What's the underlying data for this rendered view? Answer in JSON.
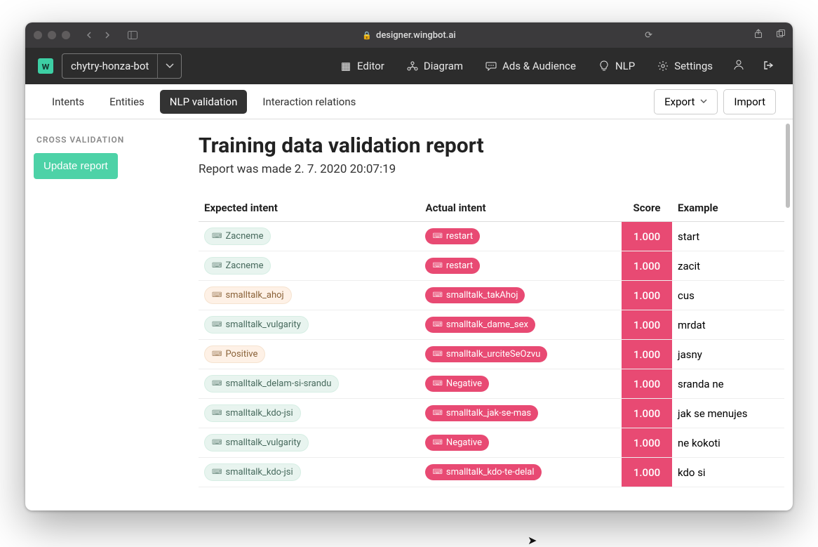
{
  "browser": {
    "url": "designer.wingbot.ai"
  },
  "topnav": {
    "bot_name": "chytry-honza-bot",
    "items": {
      "editor": "Editor",
      "diagram": "Diagram",
      "ads": "Ads & Audience",
      "nlp": "NLP",
      "settings": "Settings"
    }
  },
  "subnav": {
    "intents": "Intents",
    "entities": "Entities",
    "nlp_validation": "NLP validation",
    "interaction_relations": "Interaction relations",
    "export": "Export",
    "import": "Import"
  },
  "sidebar": {
    "heading": "CROSS VALIDATION",
    "update_button": "Update report"
  },
  "report": {
    "title": "Training data validation report",
    "subtitle": "Report was made 2. 7. 2020 20:07:19",
    "columns": {
      "expected": "Expected intent",
      "actual": "Actual intent",
      "score": "Score",
      "example": "Example"
    },
    "rows": [
      {
        "expected": "Zacneme",
        "expected_tone": "cool",
        "actual": "restart",
        "score": "1.000",
        "example": "start"
      },
      {
        "expected": "Zacneme",
        "expected_tone": "cool",
        "actual": "restart",
        "score": "1.000",
        "example": "zacit"
      },
      {
        "expected": "smalltalk_ahoj",
        "expected_tone": "warm",
        "actual": "smalltalk_takAhoj",
        "score": "1.000",
        "example": "cus"
      },
      {
        "expected": "smalltalk_vulgarity",
        "expected_tone": "cool",
        "actual": "smalltalk_dame_sex",
        "score": "1.000",
        "example": "mrdat"
      },
      {
        "expected": "Positive",
        "expected_tone": "warm",
        "actual": "smalltalk_urciteSeOzvu",
        "score": "1.000",
        "example": "jasny"
      },
      {
        "expected": "smalltalk_delam-si-srandu",
        "expected_tone": "cool",
        "actual": "Negative",
        "score": "1.000",
        "example": "sranda ne"
      },
      {
        "expected": "smalltalk_kdo-jsi",
        "expected_tone": "cool",
        "actual": "smalltalk_jak-se-mas",
        "score": "1.000",
        "example": "jak se menujes"
      },
      {
        "expected": "smalltalk_vulgarity",
        "expected_tone": "cool",
        "actual": "Negative",
        "score": "1.000",
        "example": "ne kokoti"
      },
      {
        "expected": "smalltalk_kdo-jsi",
        "expected_tone": "cool",
        "actual": "smalltalk_kdo-te-delal",
        "score": "1.000",
        "example": "kdo si"
      }
    ]
  }
}
